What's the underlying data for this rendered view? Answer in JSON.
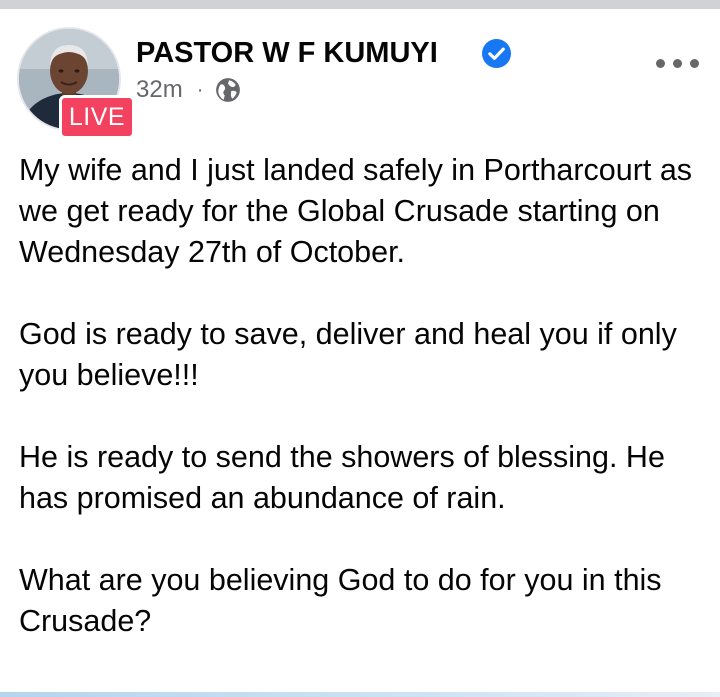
{
  "post": {
    "author": "PASTOR W F KUMUYI",
    "verified": true,
    "live_label": "LIVE",
    "timestamp": "32m",
    "separator": "·",
    "audience_icon": "globe-icon",
    "more_icon": "more-dots-icon",
    "paragraphs": [
      "My wife and I just landed safely in Portharcourt as we get ready for the Global Crusade starting on Wednesday 27th of October.",
      "God is ready to save, deliver and heal you if only you believe!!!",
      "He is ready to send the showers of blessing. He has promised an abundance of rain.",
      "What are you believing God to do for you in this  Crusade?"
    ]
  },
  "colors": {
    "live_badge": "#f3425f",
    "verified": "#1877f2",
    "meta_text": "#65676b",
    "body_text": "#050505"
  }
}
